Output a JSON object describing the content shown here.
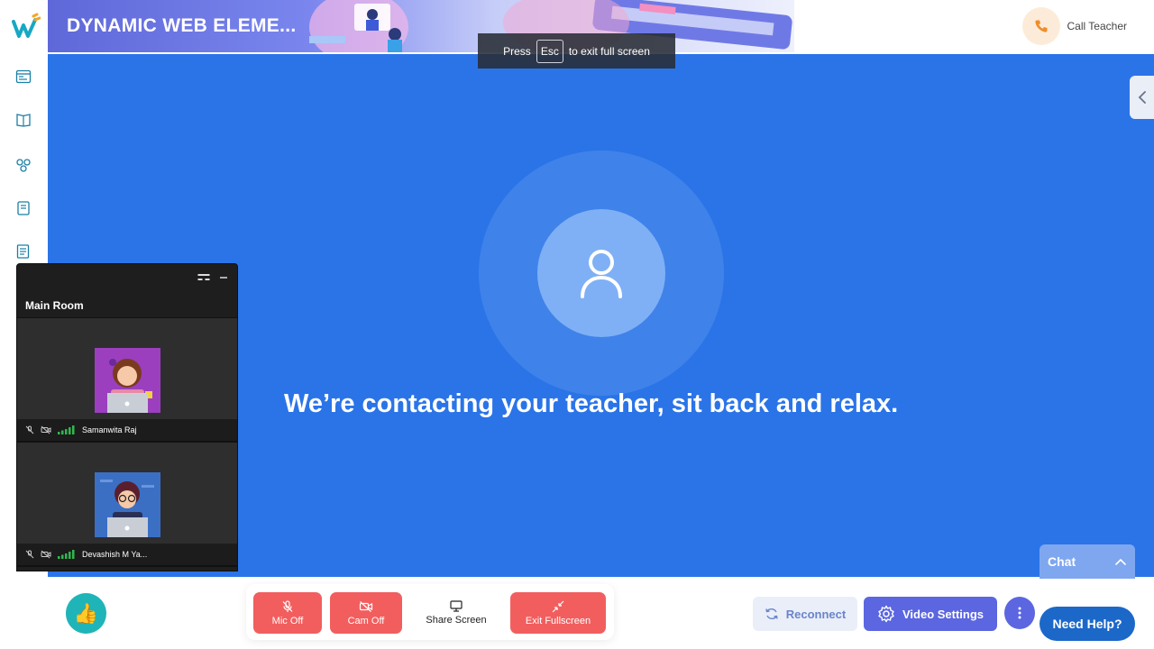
{
  "header": {
    "title": "DYNAMIC WEB ELEME...",
    "call_label": "Call Teacher"
  },
  "toast": {
    "press": "Press",
    "key": "Esc",
    "suffix": "to exit full screen"
  },
  "stage": {
    "message": "We’re contacting your teacher, sit back and relax."
  },
  "sidebar": {
    "icons": [
      "classroom-icon",
      "book-icon",
      "activity-icon",
      "notes-icon",
      "worksheet-icon"
    ]
  },
  "panel": {
    "title": "Main Room",
    "participants": [
      {
        "name": "Samanwita Raj"
      },
      {
        "name": "Devashish M Ya..."
      }
    ]
  },
  "chat": {
    "label": "Chat"
  },
  "controls": {
    "mic": "Mic Off",
    "cam": "Cam Off",
    "share": "Share Screen",
    "exit": "Exit Fullscreen"
  },
  "actions": {
    "reconnect": "Reconnect",
    "video_settings": "Video Settings",
    "need_help": "Need Help?"
  },
  "colors": {
    "stage": "#2a74e8",
    "accent": "#5b66e0",
    "danger": "#f25e5e",
    "help": "#1c68c9"
  }
}
